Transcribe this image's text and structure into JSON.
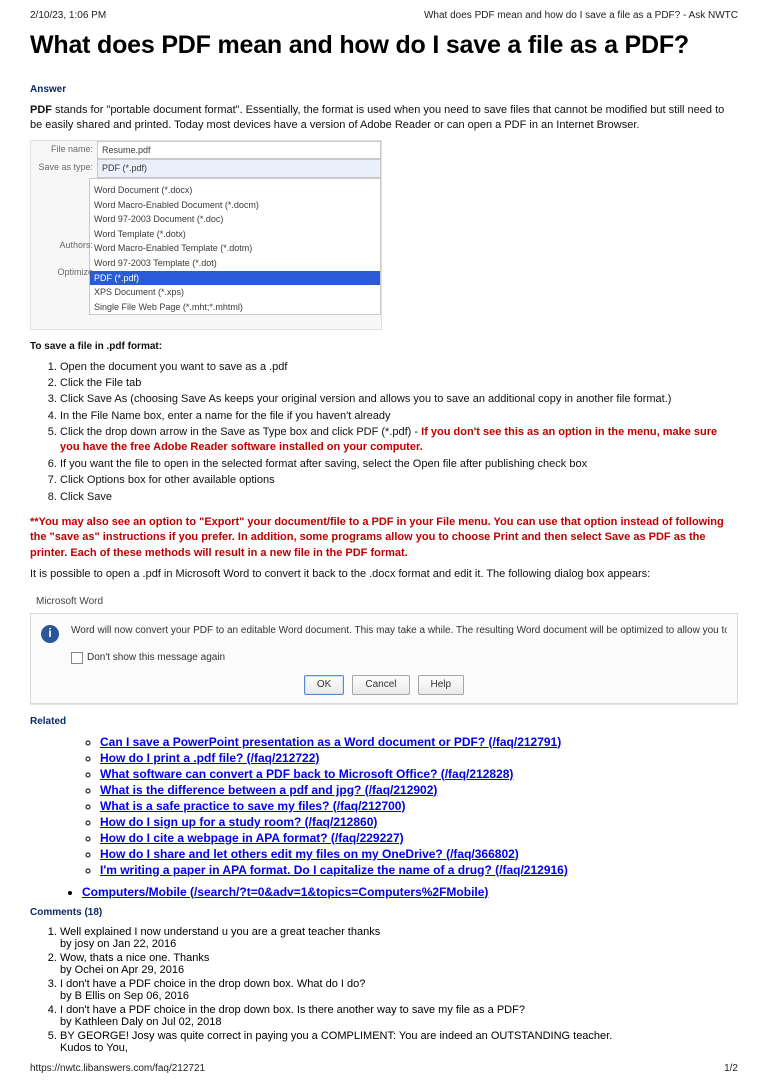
{
  "print": {
    "timestamp": "2/10/23, 1:06 PM",
    "doc_title": "What does PDF mean and how do I save a file as a PDF? - Ask NWTC",
    "url": "https://nwtc.libanswers.com/faq/212721",
    "page_indicator": "1/2"
  },
  "title": "What does PDF mean and how do I save a file as a PDF?",
  "labels": {
    "answer": "Answer",
    "related": "Related",
    "comments": "Comments (18)",
    "to_save": "To save a file in .pdf format:"
  },
  "intro": {
    "bold_lead": "PDF",
    "rest": " stands for \"portable document format\".  Essentially, the format is used when you need to save files that cannot be modified but still need to be easily shared and printed.  Today most devices have a version of Adobe Reader or can open a PDF in an Internet Browser."
  },
  "saveas": {
    "file_name_label": "File name:",
    "file_name_value": "Resume.pdf",
    "save_type_label": "Save as type:",
    "save_type_value": "PDF (*.pdf)",
    "authors_label": "Authors:",
    "optimize_label": "Optimize",
    "options": [
      {
        "text": "Word Document (*.docx)"
      },
      {
        "text": "Word Macro-Enabled Document (*.docm)"
      },
      {
        "text": "Word 97-2003 Document (*.doc)"
      },
      {
        "text": "Word Template (*.dotx)"
      },
      {
        "text": "Word Macro-Enabled Template (*.dotm)"
      },
      {
        "text": "Word 97-2003 Template (*.dot)"
      },
      {
        "text": "PDF (*.pdf)",
        "selected": true
      },
      {
        "text": "XPS Document (*.xps)"
      },
      {
        "text": "Single File Web Page (*.mht;*.mhtml)"
      }
    ]
  },
  "steps": [
    "Open the document you want to save as a .pdf",
    "Click the File tab",
    "Click Save As (choosing Save As keeps your original version and allows you to save an additional copy in another file format.)",
    "In the File Name box, enter a name for the file if you haven't already",
    "Click the drop down arrow in the Save as Type box and click PDF (*.pdf) -",
    "If you want the file to open in the selected format after saving, select the Open file after publishing check box",
    "Click Options box for other available options",
    "Click Save"
  ],
  "step5_red": "If you don't see this as an option in the menu, make sure you have the free Adobe Reader software installed on your computer.",
  "export_note": "**You may also see an option to \"Export\" your document/file to a PDF in your File menu. You can use that option instead of following the \"save as\" instructions if you prefer. In addition, some programs allow you to choose Print and then select Save as PDF as the printer. Each of these methods will result in a new file in the PDF format.",
  "convert_line": "It is possible to open a .pdf in Microsoft Word to convert it back to the .docx format and edit it. The following dialog box appears:",
  "dialog": {
    "app_title": "Microsoft Word",
    "message": "Word will now convert your PDF to an editable Word document. This may take a while. The resulting Word document will be optimized to allow you to edit the text, so it might not look exactly like the original PDF, especially if the original file contained lots of graphics.",
    "checkbox": "Don't show this message again",
    "ok": "OK",
    "cancel": "Cancel",
    "help": "Help"
  },
  "related": [
    "Can I save a PowerPoint presentation as a Word document or PDF? (/faq/212791)",
    "How do I print a .pdf file? (/faq/212722)",
    "What software can convert a PDF back to Microsoft Office? (/faq/212828)",
    "What is the difference between a pdf and jpg? (/faq/212902)",
    "What is a safe practice to save my files? (/faq/212700)",
    "How do I sign up for a study room? (/faq/212860)",
    "How do I cite a webpage in APA format? (/faq/229227)",
    "How do I share and let others edit my files on my OneDrive? (/faq/366802)",
    "I'm writing a paper in APA format. Do I capitalize the name of a drug? (/faq/212916)"
  ],
  "topic_link": "Computers/Mobile (/search/?t=0&adv=1&topics=Computers%2FMobile)",
  "comments": [
    {
      "text": "Well explained I now understand u you are a great teacher thanks",
      "by": "by josy on Jan 22, 2016"
    },
    {
      "text": "Wow, thats a nice one. Thanks",
      "by": "by Ochei on Apr 29, 2016"
    },
    {
      "text": "I don't have a PDF choice in the drop down box. What do I do?",
      "by": "by B Ellis on Sep 06, 2016"
    },
    {
      "text": "I don't have a PDF choice in the drop down box. Is there another way to save my file as a PDF?",
      "by": "by Kathleen Daly on Jul 02, 2018"
    },
    {
      "text": "BY GEORGE! Josy was quite correct in paying you a COMPLIMENT: You are indeed an OUTSTANDING teacher.",
      "extra": "Kudos to You,",
      "by": ""
    }
  ]
}
